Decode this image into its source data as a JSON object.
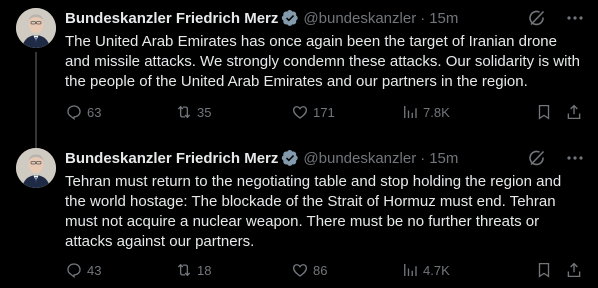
{
  "tweets": [
    {
      "author_name": "Bundeskanzler Friedrich Merz",
      "handle": "@bundeskanzler",
      "separator": "·",
      "time": "15m",
      "text": "The United Arab Emirates has once again been the target of Iranian drone and missile attacks. We strongly condemn these attacks. Our solidarity is with the people of the United Arab Emirates and our partners in the region.",
      "replies": "63",
      "reposts": "35",
      "likes": "171",
      "views": "7.8K"
    },
    {
      "author_name": "Bundeskanzler Friedrich Merz",
      "handle": "@bundeskanzler",
      "separator": "·",
      "time": "15m",
      "text": "Tehran must return to the negotiating table and stop holding the region and the world hostage: The blockade of the Strait of Hormuz must end. Tehran must not acquire a nuclear weapon. There must be no further threats or attacks against our partners.",
      "replies": "43",
      "reposts": "18",
      "likes": "86",
      "views": "4.7K"
    }
  ],
  "icons": {
    "verified": "verified-badge-icon",
    "grok": "grok-icon",
    "more": "more-icon",
    "reply": "reply-icon",
    "repost": "repost-icon",
    "like": "like-icon",
    "views": "views-icon",
    "bookmark": "bookmark-icon",
    "share": "share-icon"
  },
  "colors": {
    "background": "#000000",
    "text": "#e7e9ea",
    "muted": "#71767b",
    "verified_badge": "#829aab",
    "thread_line": "#333639"
  }
}
